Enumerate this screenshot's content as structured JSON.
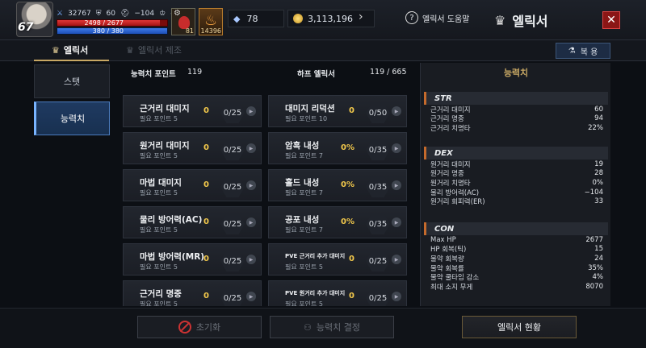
{
  "player": {
    "level": "67",
    "stat_a": "32767",
    "stat_b": "60",
    "stat_c": "−104",
    "stat_d": "–",
    "hp": "2498 / 2677",
    "mp": "380 / 380",
    "hp_fraction": 0.933,
    "mp_fraction": 1.0
  },
  "top": {
    "slot1_count": "81",
    "slot2_count": "14396",
    "diamonds": "78",
    "gold": "3,113,196",
    "help_label": "엘릭서 도움말",
    "title": "엘릭서",
    "close": "✕"
  },
  "tabs": {
    "elixir": "엘릭서",
    "craft": "엘릭서 제조",
    "restore": "복 용"
  },
  "nav": {
    "items": [
      "스탯",
      "능력치"
    ],
    "active": "능력치"
  },
  "header": {
    "points_label": "능력치 포인트",
    "points_value": "119",
    "half_label": "하프 엘릭서",
    "half_value": "119 / 665"
  },
  "cards_left": [
    {
      "name": "근거리 대미지",
      "req": "필요 포인트 5",
      "value": "0",
      "frac": "0/25"
    },
    {
      "name": "원거리 대미지",
      "req": "필요 포인트 5",
      "value": "0",
      "frac": "0/25"
    },
    {
      "name": "마법 대미지",
      "req": "필요 포인트 5",
      "value": "0",
      "frac": "0/25"
    },
    {
      "name": "물리 방어력(AC)",
      "req": "필요 포인트 5",
      "value": "0",
      "frac": "0/25"
    },
    {
      "name": "마법 방어력(MR)",
      "req": "필요 포인트 5",
      "value": "0",
      "frac": "0/25"
    },
    {
      "name": "근거리 명중",
      "req": "필요 포인트 5",
      "value": "0",
      "frac": "0/25"
    }
  ],
  "cards_right": [
    {
      "name": "대미지 리덕션",
      "req": "필요 포인트 10",
      "value": "0",
      "frac": "0/50"
    },
    {
      "name": "암흑 내성",
      "req": "필요 포인트 7",
      "value": "0%",
      "frac": "0/35"
    },
    {
      "name": "홀드 내성",
      "req": "필요 포인트 7",
      "value": "0%",
      "frac": "0/35"
    },
    {
      "name": "공포 내성",
      "req": "필요 포인트 7",
      "value": "0%",
      "frac": "0/35"
    },
    {
      "name": "PVE 근거리 추가 대미지",
      "req": "필요 포인트 5",
      "value": "0",
      "frac": "0/25"
    },
    {
      "name": "PVE 원거리 추가 대미지",
      "req": "필요 포인트 5",
      "value": "0",
      "frac": "0/25"
    }
  ],
  "panel": {
    "title": "능력치",
    "str": {
      "label": "STR",
      "rows": [
        {
          "k": "근거리 대미지",
          "v": "60"
        },
        {
          "k": "근거리 명중",
          "v": "94"
        },
        {
          "k": "근거리 치명타",
          "v": "22%"
        }
      ]
    },
    "dex": {
      "label": "DEX",
      "rows": [
        {
          "k": "원거리 대미지",
          "v": "19"
        },
        {
          "k": "원거리 명중",
          "v": "28"
        },
        {
          "k": "원거리 치명타",
          "v": "0%"
        },
        {
          "k": "물리 방어력(AC)",
          "v": "−104"
        },
        {
          "k": "원거리 회피력(ER)",
          "v": "33"
        }
      ]
    },
    "con": {
      "label": "CON",
      "rows": [
        {
          "k": "Max HP",
          "v": "2677"
        },
        {
          "k": "HP 회복(틱)",
          "v": "15"
        },
        {
          "k": "물약 회복량",
          "v": "24"
        },
        {
          "k": "물약 회복률",
          "v": "35%"
        },
        {
          "k": "물약 쿨타임 감소",
          "v": "4%"
        },
        {
          "k": "최대 소지 무게",
          "v": "8070"
        }
      ]
    }
  },
  "bottom": {
    "reset": "초기화",
    "decide": "능력치 결정",
    "status": "엘릭서 현황"
  }
}
